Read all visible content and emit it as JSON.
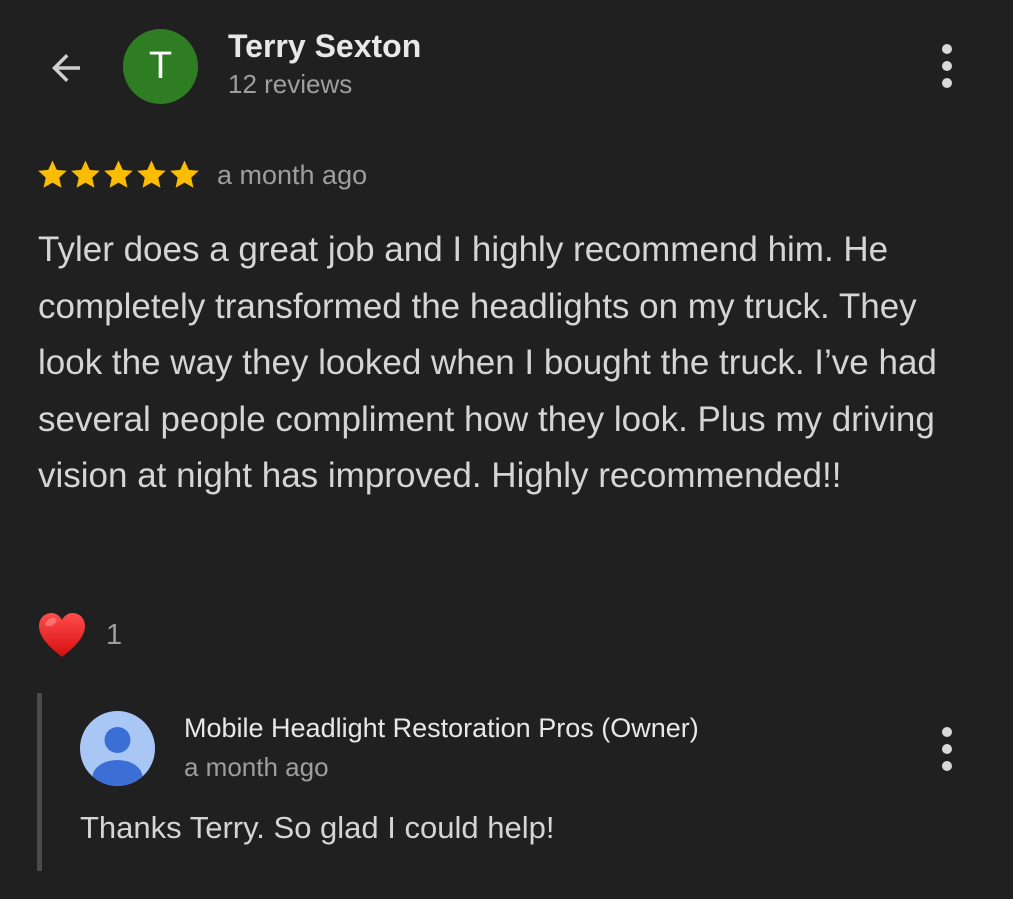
{
  "header": {
    "back_icon": "arrow-left-icon",
    "avatar_letter": "T",
    "avatar_color": "#2e7d22",
    "reviewer_name": "Terry Sexton",
    "reviewer_review_count": "12 reviews",
    "more_icon": "more-vert-icon"
  },
  "review": {
    "rating": 5,
    "rating_max": 5,
    "star_color": "#fbbc04",
    "time": "a month ago",
    "text": "Tyler does a great job and I highly recommend him. He completely transformed the headlights on my truck. They look the way they looked when I bought the truck. I’ve had several people compliment how they look. Plus my driving vision at night has improved. Highly recommended!!"
  },
  "reaction": {
    "icon": "heart-icon",
    "count": "1"
  },
  "owner_reply": {
    "avatar_icon": "person-icon",
    "avatar_color": "#a8c7f5",
    "name": "Mobile Headlight Restoration Pros (Owner)",
    "time": "a month ago",
    "text": "Thanks Terry. So glad I could help!",
    "more_icon": "more-vert-icon"
  }
}
